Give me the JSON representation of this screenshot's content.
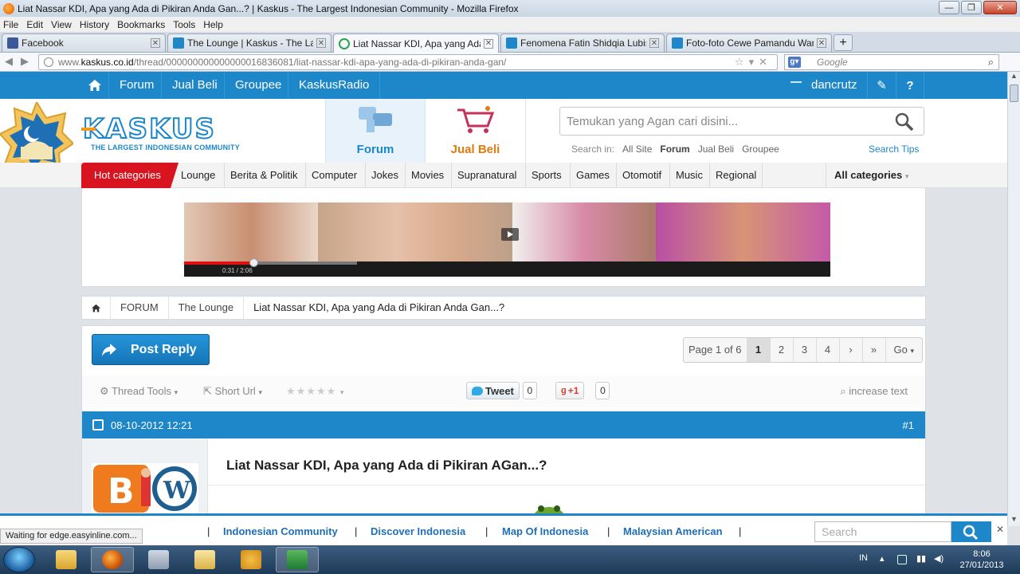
{
  "window": {
    "title": "Liat Nassar KDI, Apa yang Ada di Pikiran Anda Gan...? | Kaskus - The Largest Indonesian Community - Mozilla Firefox",
    "min": "—",
    "max": "❐",
    "close": "✕"
  },
  "menu": [
    "File",
    "Edit",
    "View",
    "History",
    "Bookmarks",
    "Tools",
    "Help"
  ],
  "tabs": [
    {
      "label": "Facebook",
      "color": "#3b5998",
      "active": false
    },
    {
      "label": "The Lounge | Kaskus - The Large...",
      "color": "#1e87c9",
      "active": false
    },
    {
      "label": "Liat Nassar KDI, Apa yang Ada di...",
      "color": "#2aa44a",
      "active": true
    },
    {
      "label": "Fenomena Fatin Shidqia Lubis, ...",
      "color": "#1e87c9",
      "active": false
    },
    {
      "label": "Foto-foto Cewe Pamandu Warn...",
      "color": "#1e87c9",
      "active": false
    }
  ],
  "newtab": "+",
  "address": {
    "prefix": "www.",
    "host": "kaskus.co.id",
    "path": "/thread/000000000000000016836081/liat-nassar-kdi-apa-yang-ada-di-pikiran-anda-gan/",
    "search_placeholder": "Google"
  },
  "topnav": {
    "items": [
      "Forum",
      "Jual Beli",
      "Groupee",
      "KaskusRadio"
    ],
    "username": "dancrutz",
    "edit_icon": "✎",
    "help_icon": "?"
  },
  "logo": {
    "word": "KASKUS",
    "tagline": "THE LARGEST INDONESIAN COMMUNITY"
  },
  "tiles": {
    "forum": "Forum",
    "jualbeli": "Jual Beli"
  },
  "search": {
    "placeholder": "Temukan yang Agan cari disini...",
    "in_label": "Search in:",
    "options": [
      "All Site",
      "Forum",
      "Jual Beli",
      "Groupee"
    ],
    "selected": "Forum",
    "tips": "Search Tips"
  },
  "categories": {
    "hot": "Hot categories",
    "items": [
      "Lounge",
      "Berita & Politik",
      "Computer",
      "Jokes",
      "Movies",
      "Supranatural",
      "Sports",
      "Games",
      "Otomotif",
      "Music",
      "Regional"
    ],
    "all": "All categories"
  },
  "ad": {
    "time": "0:31 / 2:06"
  },
  "breadcrumb": {
    "items": [
      "FORUM",
      "The Lounge"
    ],
    "current": "Liat Nassar KDI, Apa yang Ada di Pikiran Anda Gan...?"
  },
  "thread": {
    "post_reply": "Post Reply",
    "pager": {
      "label": "Page 1 of 6",
      "pages": [
        "1",
        "2",
        "3",
        "4"
      ],
      "current": "1",
      "next": "›",
      "last": "»",
      "go": "Go"
    },
    "tools": {
      "thread_tools": "Thread Tools",
      "short_url": "Short Url",
      "stars": "★★★★★",
      "increase": "increase text"
    },
    "tweet": {
      "label": "Tweet",
      "count": "0"
    },
    "gplus": {
      "label": "+1",
      "count": "0"
    },
    "post": {
      "date": "08-10-2012 12:21",
      "number": "#1",
      "title": "Liat Nassar KDI, Apa yang Ada di Pikiran AGan...?"
    }
  },
  "footer": {
    "links": [
      "Indonesian Community",
      "Discover Indonesia",
      "Map Of Indonesia",
      "Malaysian American"
    ],
    "search_placeholder": "Search",
    "close": "✕"
  },
  "status": "Waiting for edge.easyinline.com...",
  "taskbar": {
    "lang": "IN",
    "time": "8:06",
    "date": "27/01/2013"
  }
}
